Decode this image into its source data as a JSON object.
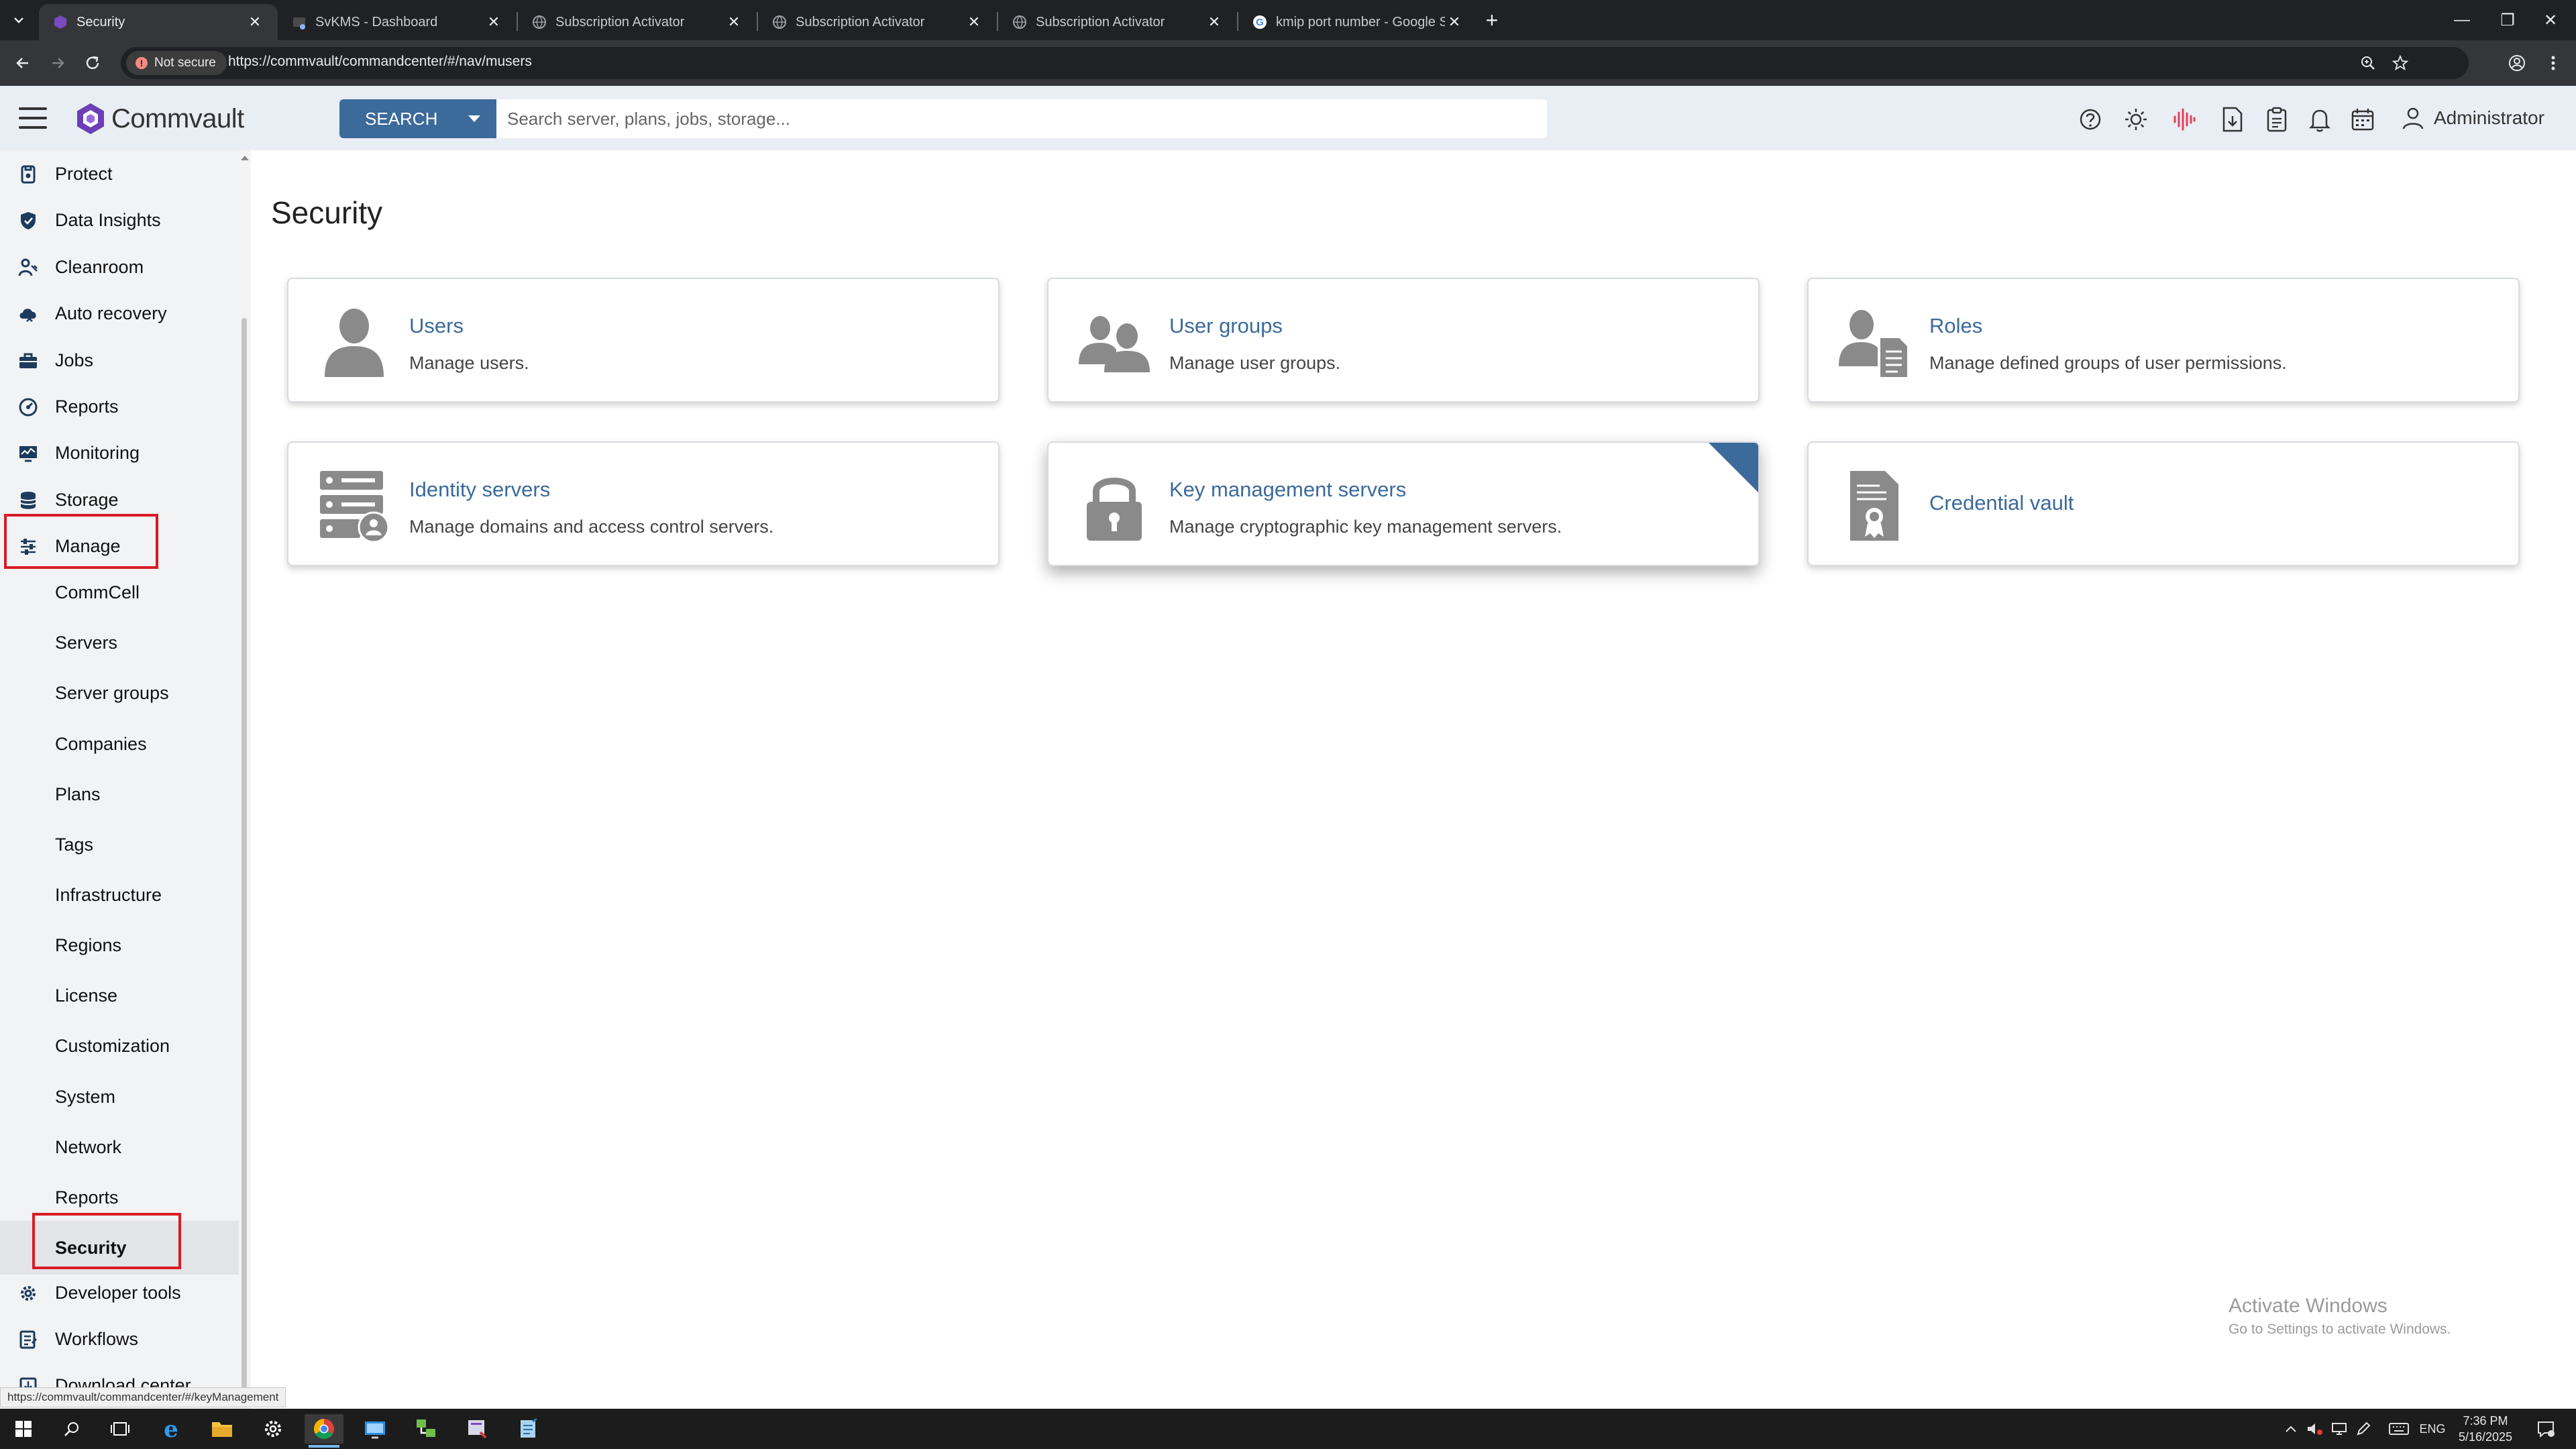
{
  "browser": {
    "tabs": [
      {
        "title": "Security",
        "active": true
      },
      {
        "title": "SvKMS - Dashboard",
        "active": false
      },
      {
        "title": "Subscription Activator",
        "active": false
      },
      {
        "title": "Subscription Activator",
        "active": false
      },
      {
        "title": "Subscription Activator",
        "active": false
      },
      {
        "title": "kmip port number - Google Se",
        "active": false
      }
    ],
    "security_chip": "Not secure",
    "url": "https://commvault/commandcenter/#/nav/musers",
    "status_url": "https://commvault/commandcenter/#/keyManagement"
  },
  "header": {
    "logo_text": "Commvault",
    "search_button": "SEARCH",
    "search_placeholder": "Search server, plans, jobs, storage...",
    "user_name": "Administrator",
    "icons": [
      "help-icon",
      "theme-sun-icon",
      "activity-icon",
      "download-icon",
      "clipboard-icon",
      "bell-icon",
      "calendar-icon",
      "user-icon"
    ]
  },
  "sidebar": {
    "top_items": [
      {
        "label": "Protect",
        "icon": "protect-icon"
      },
      {
        "label": "Data Insights",
        "icon": "shield-icon"
      },
      {
        "label": "Cleanroom",
        "icon": "cleanroom-icon"
      },
      {
        "label": "Auto recovery",
        "icon": "cloud-recovery-icon"
      },
      {
        "label": "Jobs",
        "icon": "briefcase-icon"
      },
      {
        "label": "Reports",
        "icon": "gauge-icon"
      },
      {
        "label": "Monitoring",
        "icon": "monitor-icon"
      },
      {
        "label": "Storage",
        "icon": "database-icon"
      },
      {
        "label": "Manage",
        "icon": "sliders-icon"
      }
    ],
    "manage_children": [
      {
        "label": "CommCell"
      },
      {
        "label": "Servers"
      },
      {
        "label": "Server groups"
      },
      {
        "label": "Companies"
      },
      {
        "label": "Plans"
      },
      {
        "label": "Tags"
      },
      {
        "label": "Infrastructure"
      },
      {
        "label": "Regions"
      },
      {
        "label": "License"
      },
      {
        "label": "Customization"
      },
      {
        "label": "System"
      },
      {
        "label": "Network"
      },
      {
        "label": "Reports"
      },
      {
        "label": "Security"
      }
    ],
    "bottom_items": [
      {
        "label": "Developer tools",
        "icon": "gear-icon"
      },
      {
        "label": "Workflows",
        "icon": "workflow-icon"
      },
      {
        "label": "Download center",
        "icon": "download-icon"
      }
    ],
    "selected": "Security"
  },
  "main": {
    "title": "Security",
    "cards": [
      {
        "title": "Users",
        "description": "Manage users.",
        "icon": "user-icon"
      },
      {
        "title": "User groups",
        "description": "Manage user groups.",
        "icon": "user-group-icon"
      },
      {
        "title": "Roles",
        "description": "Manage defined groups of user permissions.",
        "icon": "role-icon"
      },
      {
        "title": "Identity servers",
        "description": "Manage domains and access control servers.",
        "icon": "identity-server-icon"
      },
      {
        "title": "Key management servers",
        "description": "Manage cryptographic key management servers.",
        "icon": "lock-icon"
      },
      {
        "title": "Credential vault",
        "description": "",
        "icon": "certificate-icon"
      }
    ]
  },
  "watermark": {
    "line1": "Activate Windows",
    "line2": "Go to Settings to activate Windows."
  },
  "taskbar": {
    "language": "ENG",
    "time": "7:36 PM",
    "date": "5/16/2025"
  }
}
